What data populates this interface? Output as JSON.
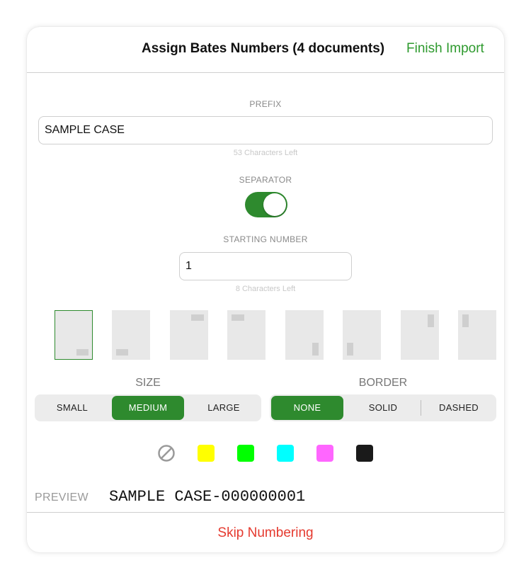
{
  "header": {
    "title": "Assign Bates Numbers (4 documents)",
    "finish_label": "Finish Import"
  },
  "prefix": {
    "caption": "PREFIX",
    "value": "SAMPLE CASE",
    "hint": "53 Characters Left"
  },
  "separator": {
    "caption": "SEPARATOR",
    "enabled": true
  },
  "starting_number": {
    "caption": "STARTING NUMBER",
    "value": "1",
    "hint": "8 Characters Left"
  },
  "positions": [
    {
      "id": "bottom-right",
      "selected": true
    },
    {
      "id": "bottom-left",
      "selected": false
    },
    {
      "id": "top-right",
      "selected": false
    },
    {
      "id": "top-left",
      "selected": false
    },
    {
      "id": "right-bottom-vertical",
      "selected": false
    },
    {
      "id": "left-bottom-vertical",
      "selected": false
    },
    {
      "id": "right-top-vertical",
      "selected": false
    },
    {
      "id": "left-top-vertical",
      "selected": false
    }
  ],
  "size": {
    "label": "SIZE",
    "options": [
      "SMALL",
      "MEDIUM",
      "LARGE"
    ],
    "selected": "MEDIUM"
  },
  "border": {
    "label": "BORDER",
    "options": [
      "NONE",
      "SOLID",
      "DASHED"
    ],
    "selected": "NONE"
  },
  "colors": {
    "none_icon": "no-color-icon",
    "swatches": [
      "#ffff00",
      "#00ff00",
      "#00ffff",
      "#ff66ff",
      "#1a1a1a"
    ]
  },
  "accent": "#2e8a2e",
  "preview": {
    "label": "PREVIEW",
    "value": "SAMPLE CASE-000000001"
  },
  "footer": {
    "skip_label": "Skip Numbering"
  }
}
